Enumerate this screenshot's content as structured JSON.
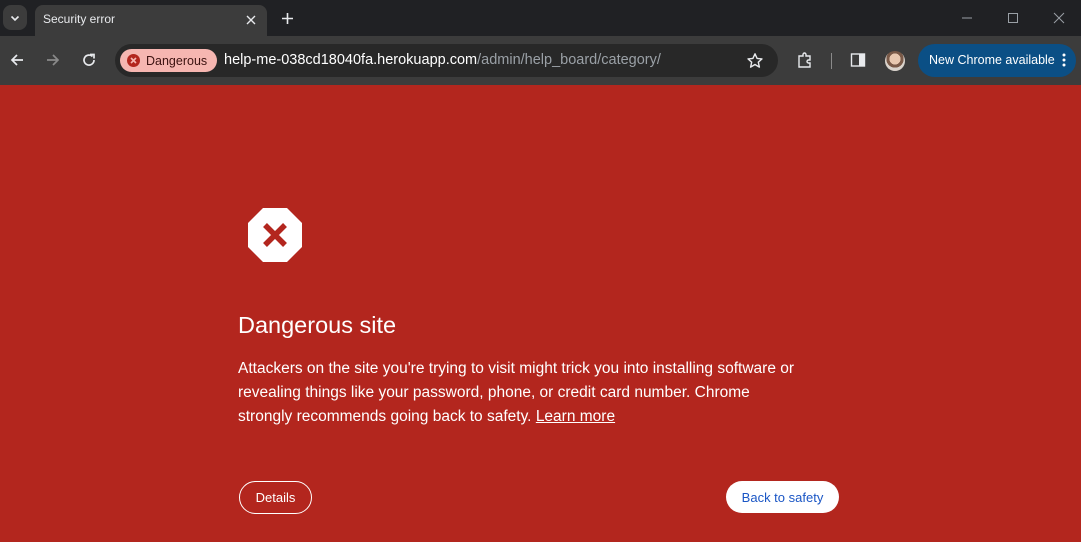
{
  "tab": {
    "title": "Security error"
  },
  "omnibox": {
    "chip_label": "Dangerous",
    "host": "help-me-038cd18040fa.herokuapp.com",
    "path": "/admin/help_board/category/"
  },
  "update_button": {
    "label": "New Chrome available"
  },
  "interstitial": {
    "heading": "Dangerous site",
    "body": "Attackers on the site you're trying to visit might trick you into installing software or revealing things like your password, phone, or credit card number. Chrome strongly recommends going back to safety.",
    "learn_more": "Learn more",
    "details_label": "Details",
    "back_label": "Back to safety"
  },
  "colors": {
    "danger_background": "#b3261e",
    "chip_background": "#f6b6b1",
    "update_button": "#0b4f85",
    "back_button_text": "#1a56c5"
  },
  "icons": [
    "tab-search-icon",
    "close-icon",
    "plus-icon",
    "minimize-icon",
    "maximize-icon",
    "back-arrow-icon",
    "forward-arrow-icon",
    "reload-icon",
    "danger-icon",
    "star-icon",
    "extensions-icon",
    "side-panel-icon",
    "kebab-menu-icon",
    "danger-stop-sign-icon"
  ]
}
